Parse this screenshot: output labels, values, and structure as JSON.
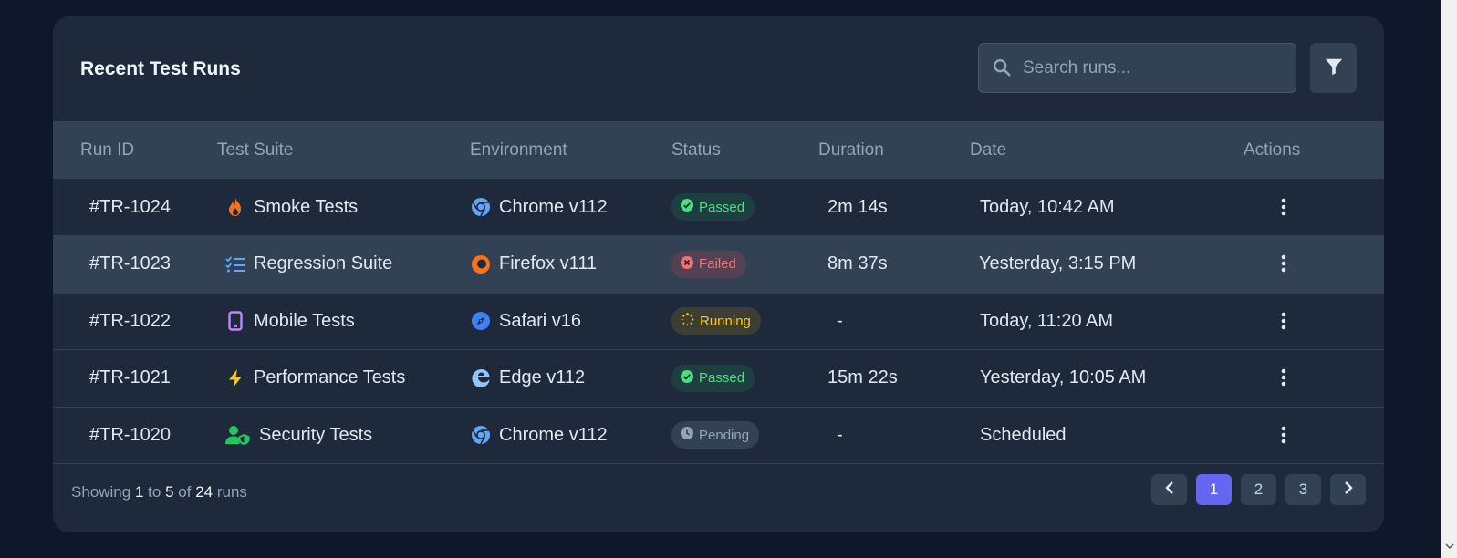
{
  "card": {
    "title": "Recent Test Runs",
    "search_placeholder": "Search runs..."
  },
  "table": {
    "headers": [
      "Run ID",
      "Test Suite",
      "Environment",
      "Status",
      "Duration",
      "Date",
      "Actions"
    ],
    "rows": [
      {
        "id": "#TR-1024",
        "suite": "Smoke Tests",
        "suite_icon": "fire-icon",
        "env": "Chrome v112",
        "env_icon": "chrome-icon",
        "status": "Passed",
        "duration": "2m 14s",
        "date": "Today, 10:42 AM"
      },
      {
        "id": "#TR-1023",
        "suite": "Regression Suite",
        "suite_icon": "checklist-icon",
        "env": "Firefox v111",
        "env_icon": "firefox-icon",
        "status": "Failed",
        "duration": "8m 37s",
        "date": "Yesterday, 3:15 PM"
      },
      {
        "id": "#TR-1022",
        "suite": "Mobile Tests",
        "suite_icon": "mobile-icon",
        "env": "Safari v16",
        "env_icon": "safari-icon",
        "status": "Running",
        "duration": "-",
        "date": "Today, 11:20 AM"
      },
      {
        "id": "#TR-1021",
        "suite": "Performance Tests",
        "suite_icon": "bolt-icon",
        "env": "Edge v112",
        "env_icon": "edge-icon",
        "status": "Passed",
        "duration": "15m 22s",
        "date": "Yesterday, 10:05 AM"
      },
      {
        "id": "#TR-1020",
        "suite": "Security Tests",
        "suite_icon": "user-shield-icon",
        "env": "Chrome v112",
        "env_icon": "chrome-icon",
        "status": "Pending",
        "duration": "-",
        "date": "Scheduled"
      }
    ]
  },
  "footer": {
    "showing_prefix": "Showing",
    "from": "1",
    "to_word": "to",
    "to": "5",
    "of_word": "of",
    "total": "24",
    "suffix": "runs"
  },
  "pagination": {
    "pages": [
      "1",
      "2",
      "3"
    ],
    "active": "1"
  },
  "colors": {
    "background": "#0f172a",
    "card": "#1e293b",
    "header_row": "#334155",
    "accent": "#6366f1",
    "passed": "#4ade80",
    "failed": "#f87171",
    "running": "#facc15",
    "pending": "#94a3b8"
  }
}
